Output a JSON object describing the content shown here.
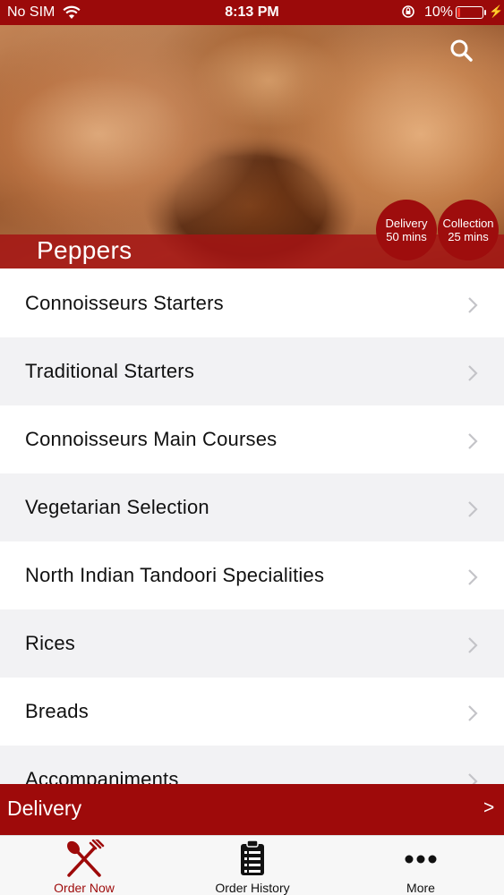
{
  "status_bar": {
    "carrier": "No SIM",
    "time": "8:13 PM",
    "battery_percent": "10%",
    "battery_level": 0.1
  },
  "header": {
    "restaurant_name": "Peppers",
    "delivery_badge": {
      "label": "Delivery",
      "time": "50 mins"
    },
    "collection_badge": {
      "label": "Collection",
      "time": "25 mins"
    }
  },
  "menu": {
    "categories": [
      "Connoisseurs Starters",
      "Traditional Starters",
      "Connoisseurs Main Courses",
      "Vegetarian Selection",
      "North Indian Tandoori Specialities",
      "Rices",
      "Breads",
      "Accompaniments"
    ]
  },
  "order_bar": {
    "mode": "Delivery",
    "arrow": ">"
  },
  "tabs": [
    {
      "label": "Order Now",
      "icon": "fork-knife-icon",
      "active": true
    },
    {
      "label": "Order History",
      "icon": "clipboard-list-icon",
      "active": false
    },
    {
      "label": "More",
      "icon": "more-dots-icon",
      "active": false
    }
  ],
  "colors": {
    "brand": "#9e0a0a",
    "row_alt": "#f2f2f4",
    "active_tab": "#9e0a0a"
  }
}
